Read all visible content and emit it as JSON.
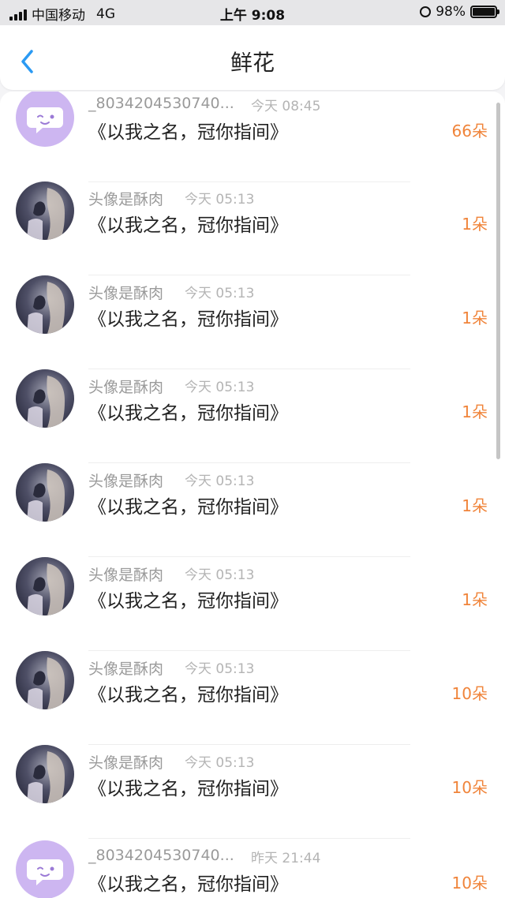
{
  "status_bar": {
    "carrier": "中国移动",
    "network": "4G",
    "time": "上午 9:08",
    "battery": "98%"
  },
  "nav": {
    "title": "鲜花"
  },
  "rows": [
    {
      "name": "_8034204530740...",
      "time": "今天 08:45",
      "message": "《以我之名，冠你指间》",
      "count": "66朵",
      "avatar": "chat-bubble"
    },
    {
      "name": "头像是酥肉",
      "time": "今天 05:13",
      "message": "《以我之名，冠你指间》",
      "count": "1朵",
      "avatar": "photo"
    },
    {
      "name": "头像是酥肉",
      "time": "今天 05:13",
      "message": "《以我之名，冠你指间》",
      "count": "1朵",
      "avatar": "photo"
    },
    {
      "name": "头像是酥肉",
      "time": "今天 05:13",
      "message": "《以我之名，冠你指间》",
      "count": "1朵",
      "avatar": "photo"
    },
    {
      "name": "头像是酥肉",
      "time": "今天 05:13",
      "message": "《以我之名，冠你指间》",
      "count": "1朵",
      "avatar": "photo"
    },
    {
      "name": "头像是酥肉",
      "time": "今天 05:13",
      "message": "《以我之名，冠你指间》",
      "count": "1朵",
      "avatar": "photo"
    },
    {
      "name": "头像是酥肉",
      "time": "今天 05:13",
      "message": "《以我之名，冠你指间》",
      "count": "10朵",
      "avatar": "photo"
    },
    {
      "name": "头像是酥肉",
      "time": "今天 05:13",
      "message": "《以我之名，冠你指间》",
      "count": "10朵",
      "avatar": "photo"
    },
    {
      "name": "_8034204530740...",
      "time": "昨天 21:44",
      "message": "《以我之名，冠你指间》",
      "count": "10朵",
      "avatar": "chat-bubble"
    }
  ],
  "colors": {
    "accent": "#2b9af3",
    "count": "#f0843a",
    "avatar_bg": "#cdb6f1"
  }
}
